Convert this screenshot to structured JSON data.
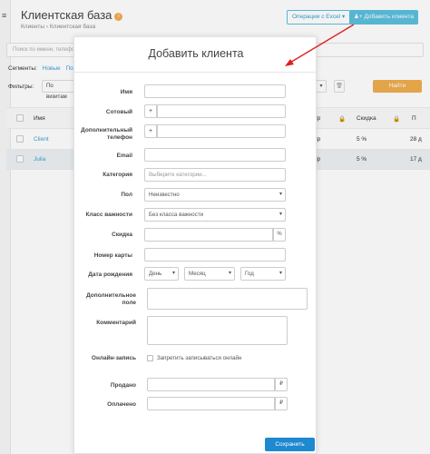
{
  "app": {
    "title": "Клиентская база",
    "info_badge": "i",
    "breadcrumb": [
      "Клиенты",
      "Клиентская база"
    ],
    "excel_button": "Операции с Excel ▾",
    "add_client_button": "Добавить клиента",
    "search_placeholder": "Поиск по имени, телефону",
    "segments_label": "Сегменты:",
    "segments": [
      "Новые",
      "Пов"
    ],
    "filters_label": "Фильтры:",
    "filter_select": "По визитам",
    "find_button": "Найти"
  },
  "table": {
    "headers": {
      "name": "Имя",
      "p": "Пр",
      "disc": "Скидка",
      "last": "П"
    },
    "rows": [
      {
        "name": "Client",
        "p": "Пр",
        "disc": "5 %",
        "date": "28 д"
      },
      {
        "name": "Julia",
        "p": "Пр",
        "disc": "5 %",
        "date": "17 д"
      }
    ]
  },
  "modal": {
    "title": "Добавить клиента",
    "fields": {
      "name": {
        "label": "Имя",
        "value": ""
      },
      "mobile": {
        "label": "Сотовый",
        "prefix": "+",
        "value": ""
      },
      "extra_phone": {
        "label": "Дополнительный телефон",
        "prefix": "+",
        "value": ""
      },
      "email": {
        "label": "Email",
        "value": ""
      },
      "category": {
        "label": "Категория",
        "placeholder": "Выберите категории..."
      },
      "gender": {
        "label": "Пол",
        "value": "Неизвестно"
      },
      "importance": {
        "label": "Класс важности",
        "value": "Без класса важности"
      },
      "discount": {
        "label": "Скидка",
        "suffix": "%",
        "value": ""
      },
      "card": {
        "label": "Номер карты",
        "value": ""
      },
      "birthday": {
        "label": "Дата рождения",
        "day": "День",
        "month": "Месяц",
        "year": "Год"
      },
      "extra_field": {
        "label": "Дополнительное поле",
        "value": ""
      },
      "comment": {
        "label": "Комментарий",
        "value": ""
      },
      "online": {
        "label": "Онлайн-запись",
        "checkbox": "Запретить записываться онлайн",
        "checked": false
      },
      "sold": {
        "label": "Продано",
        "suffix": "₽",
        "value": ""
      },
      "paid": {
        "label": "Оплачено",
        "suffix": "₽",
        "value": ""
      }
    },
    "save_button": "Сохранить"
  },
  "colors": {
    "accent": "#5bc0de",
    "primary_button": "#1e88d0",
    "find_button": "#f0ad4e",
    "link": "#3aa0d8",
    "arrow": "#e02020"
  },
  "icons": [
    "menu-icon",
    "info-icon",
    "user-plus-icon",
    "trash-icon",
    "chevron-down-icon",
    "arrow-annotation-icon"
  ]
}
